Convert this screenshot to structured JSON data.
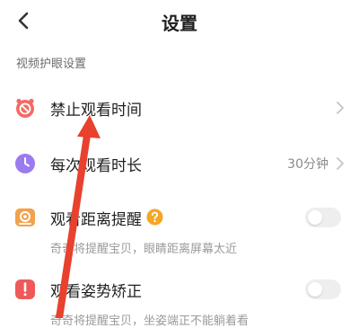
{
  "header": {
    "title": "设置"
  },
  "section": {
    "title": "视频护眼设置"
  },
  "items": [
    {
      "label": "禁止观看时间",
      "value": ""
    },
    {
      "label": "每次观看时长",
      "value": "30分钟"
    },
    {
      "label": "观看距离提醒",
      "subtitle": "奇奇将提醒宝贝，眼睛距离屏幕太近",
      "toggle_on": false
    },
    {
      "label": "观看姿势矫正",
      "subtitle": "奇奇将提醒宝贝，坐姿端正不能躺着看",
      "toggle_on": false
    }
  ],
  "colors": {
    "ban_icon": "#f26b63",
    "duration_icon": "#9b7bf0",
    "distance_icon": "#f3a14b",
    "posture_icon": "#ee5a5a",
    "help_icon": "#f5a623",
    "annotation_arrow": "#e8412e"
  },
  "icons": {
    "back": "back-arrow-icon",
    "ban": "alarm-ban-icon",
    "duration": "clock-icon",
    "distance": "distance-icon",
    "posture": "posture-icon",
    "help": "question-icon"
  }
}
